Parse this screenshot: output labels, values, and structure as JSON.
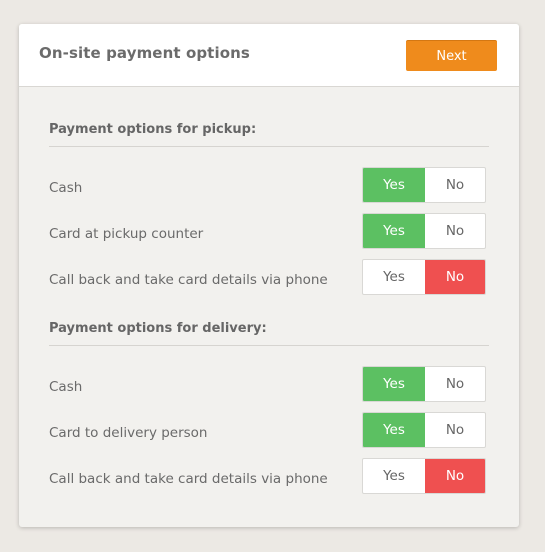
{
  "header": {
    "title": "On-site payment options",
    "next_label": "Next"
  },
  "colors": {
    "accent": "#ef8b1c",
    "yes_active": "#5cc062",
    "no_active": "#ef5050"
  },
  "sections": [
    {
      "title": "Payment options for pickup:",
      "options": [
        {
          "label": "Cash",
          "yes": "Yes",
          "no": "No",
          "value": "yes"
        },
        {
          "label": "Card at pickup counter",
          "yes": "Yes",
          "no": "No",
          "value": "yes"
        },
        {
          "label": "Call back and take card details via phone",
          "yes": "Yes",
          "no": "No",
          "value": "no"
        }
      ]
    },
    {
      "title": "Payment options for delivery:",
      "options": [
        {
          "label": "Cash",
          "yes": "Yes",
          "no": "No",
          "value": "yes"
        },
        {
          "label": "Card to delivery person",
          "yes": "Yes",
          "no": "No",
          "value": "yes"
        },
        {
          "label": "Call back and take card details via phone",
          "yes": "Yes",
          "no": "No",
          "value": "no"
        }
      ]
    }
  ]
}
